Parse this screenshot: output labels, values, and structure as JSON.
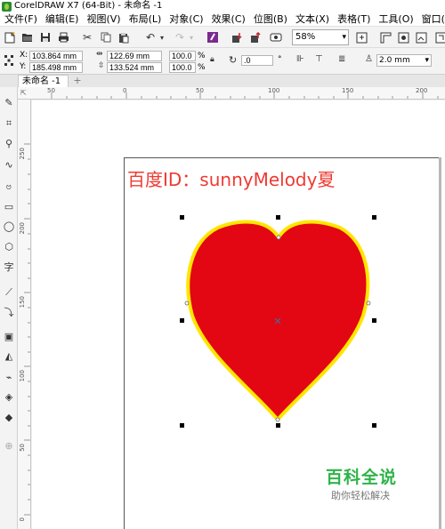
{
  "window": {
    "title": "CorelDRAW X7 (64-Bit) - 未命名 -1"
  },
  "menu": [
    "文件(F)",
    "编辑(E)",
    "视图(V)",
    "布局(L)",
    "对象(C)",
    "效果(C)",
    "位图(B)",
    "文本(X)",
    "表格(T)",
    "工具(O)",
    "窗口(W)"
  ],
  "toolbar": {
    "zoom": "58%"
  },
  "properties": {
    "x_label": "X:",
    "x_value": "103.864 mm",
    "y_label": "Y:",
    "y_value": "185.498 mm",
    "w_value": "122.69 mm",
    "h_value": "133.524 mm",
    "scale_w": "100.0",
    "scale_h": "100.0",
    "percent": "%",
    "rotation": ".0",
    "degree": "°",
    "outline_width": "2.0 mm"
  },
  "document": {
    "tab_label": "未命名 -1",
    "add_tab": "+"
  },
  "ruler": {
    "h_labels": [
      "50",
      "0",
      "50",
      "100",
      "150",
      "200"
    ],
    "v_labels": [
      "250",
      "200",
      "150",
      "100",
      "50",
      "0"
    ]
  },
  "canvas": {
    "watermark_text": "百度ID：sunnyMelody夏",
    "shape": {
      "type": "heart",
      "fill": "#e30613",
      "outline": "#ffe600"
    },
    "brand_title": "百科全说",
    "brand_subtitle": "助你轻松解决"
  },
  "colors": {
    "accent_green": "#2fb34a",
    "watermark_red": "#ef3a32"
  }
}
